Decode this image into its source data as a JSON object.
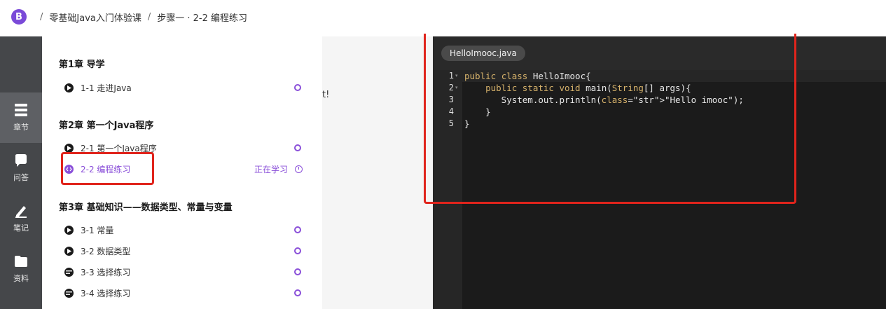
{
  "header": {
    "logo_text": "B",
    "breadcrumb": [
      "零基础Java入门体验课",
      "步骤一 · 2-2 编程练习"
    ],
    "separator": "/"
  },
  "leftnav": [
    {
      "label": "章节",
      "icon": "list-icon",
      "active": true
    },
    {
      "label": "问答",
      "icon": "chat-icon",
      "active": false
    },
    {
      "label": "笔记",
      "icon": "pen-icon",
      "active": false
    },
    {
      "label": "资料",
      "icon": "folder-icon",
      "active": false
    }
  ],
  "chapters": [
    {
      "title": "第1章 导学",
      "lessons": [
        {
          "name": "1-1 走进Java",
          "icon": "play-icon"
        }
      ]
    },
    {
      "title": "第2章 第一个Java程序",
      "lessons": [
        {
          "name": "2-1 第一个Java程序",
          "icon": "play-icon"
        },
        {
          "name": "2-2 编程练习",
          "icon": "code-icon",
          "current": true,
          "status": "正在学习"
        }
      ]
    },
    {
      "title": "第3章 基础知识——数据类型、常量与变量",
      "lessons": [
        {
          "name": "3-1 常量",
          "icon": "play-icon"
        },
        {
          "name": "3-2 数据类型",
          "icon": "play-icon"
        },
        {
          "name": "3-3 选择练习",
          "icon": "quiz-icon"
        },
        {
          "name": "3-4 选择练习",
          "icon": "quiz-icon"
        }
      ]
    }
  ],
  "mid_stub": "t!",
  "editor": {
    "file_tab": "HelloImooc.java",
    "line_numbers": [
      "1",
      "2",
      "3",
      "4",
      "5"
    ],
    "code_lines": [
      "public class HelloImooc{",
      "    public static void main(String[] args){",
      "       System.out.println(\"Hello imooc\");",
      "    }",
      "}"
    ]
  },
  "colors": {
    "accent": "#8a4fd9",
    "highlight_box": "#e0241c",
    "editor_bg": "#1b1b1b",
    "nav_bg": "#45474a"
  }
}
